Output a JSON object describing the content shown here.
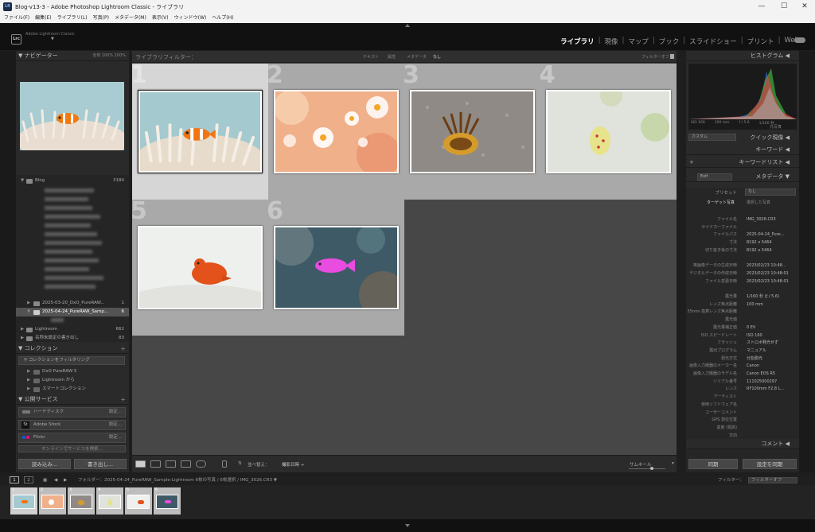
{
  "window": {
    "app_icon": "LR",
    "title": "Blog-v13-3 - Adobe Photoshop Lightroom Classic - ライブラリ",
    "minimize": "—",
    "maximize": "☐",
    "close": "✕"
  },
  "menu": [
    "ファイル(F)",
    "編集(E)",
    "ライブラリ(L)",
    "写真(P)",
    "メタデータ(M)",
    "表示(V)",
    "ウィンドウ(W)",
    "ヘルプ(H)"
  ],
  "identity": {
    "logo": "Lrc",
    "brand": "Adobe Lightroom Classic",
    "arrow": "▼"
  },
  "modules": [
    "ライブラリ",
    "現像",
    "マップ",
    "ブック",
    "スライドショー",
    "プリント",
    "Web"
  ],
  "module_sep": "|",
  "left": {
    "navigator": {
      "title": "ナビゲーター",
      "fit": "全体",
      "zoom1": "100%",
      "zoom2": "100%"
    },
    "folders": {
      "root": {
        "name": "Blog",
        "count": "3184"
      },
      "items": [
        {
          "name": "2025-03-20_DxO_PureRAW...",
          "count": "1"
        },
        {
          "name": "2025-04-24_PureRAW_Samp...",
          "count": "6"
        },
        {
          "name": "Lightroom",
          "count": "662"
        },
        {
          "name": "名称未設定の書き出し",
          "count": "83"
        }
      ]
    },
    "collections": {
      "title": "コレクション",
      "filter": "コレクションをフィルタリング",
      "items": [
        "DxO PureRAW 5",
        "Lightroom から",
        "スマートコレクション"
      ]
    },
    "publish": {
      "title": "公開サービス",
      "items": [
        {
          "name": "ハードディスク",
          "setting": "設定..."
        },
        {
          "name": "Adobe Stock",
          "setting": "設定..."
        },
        {
          "name": "Flickr",
          "setting": "設定..."
        }
      ],
      "more": "オンラインでサービスを検索..."
    },
    "import_btn": "読み込み...",
    "export_btn": "書き出し..."
  },
  "center": {
    "filter_label": "ライブラリフィルター：",
    "filter_tabs": [
      "テキスト",
      "属性",
      "メタデータ",
      "なし"
    ],
    "filter_off": "フィルターオフ ÷",
    "cells": [
      "1",
      "2",
      "3",
      "4",
      "5",
      "6"
    ],
    "toolbar": {
      "sort_label": "並べ替え：",
      "sort_value": "撮影日時 ÷",
      "thumb_label": "サムネール"
    }
  },
  "right": {
    "histogram": {
      "title": "ヒストグラム",
      "iso": "ISO 160",
      "focal": "100 mm",
      "aperture": "f / 5.6",
      "shutter": "1/160 秒"
    },
    "original": "元写真",
    "quick_develop": {
      "title": "クイック現像",
      "preset": "カスタム"
    },
    "keywording": "キーワード",
    "keyword_list": "キーワードリスト",
    "metadata": {
      "title": "メタデータ",
      "mode": "Exif",
      "preset_label": "プリセット",
      "preset_value": "なし",
      "tab1": "ターゲット写真",
      "tab2": "選択した写真",
      "rows": [
        {
          "k": "ファイル名",
          "v": "IMG_3026.CR3"
        },
        {
          "k": "サイドカーファイル",
          "v": ""
        },
        {
          "k": "ファイルパス",
          "v": "2025-04-24_Pure..."
        },
        {
          "k": "寸法",
          "v": "8192 x 5464"
        },
        {
          "k": "切り抜き後の寸法",
          "v": "8192 x 5464"
        },
        {
          "k": "",
          "v": ""
        },
        {
          "k": "英画像データの生成日時",
          "v": "2023/02/23 10:48..."
        },
        {
          "k": "デジタルデータの作成日時",
          "v": "2023/02/23 10:48:01"
        },
        {
          "k": "ファイル変更日時",
          "v": "2023/02/23 10:48:01"
        },
        {
          "k": "",
          "v": ""
        },
        {
          "k": "露光量",
          "v": "1/160 秒 (ƒ / 5.6)"
        },
        {
          "k": "レンズ焦点距離",
          "v": "100 mm"
        },
        {
          "k": "35mm 換算レンズ焦点距離",
          "v": ""
        },
        {
          "k": "露光値",
          "v": ""
        },
        {
          "k": "露光量補正値",
          "v": "0 EV"
        },
        {
          "k": "ISO スピードレート",
          "v": "ISO 160"
        },
        {
          "k": "フラッシュ",
          "v": "ストロボ発光せず"
        },
        {
          "k": "露出プログラム",
          "v": "マニュアル"
        },
        {
          "k": "測光方式",
          "v": "分割測光"
        },
        {
          "k": "画像入力機器のメーカー名",
          "v": "Canon"
        },
        {
          "k": "画像入力機器のモデル名",
          "v": "Canon EOS R5"
        },
        {
          "k": "シリアル番号",
          "v": "111025000297"
        },
        {
          "k": "レンズ",
          "v": "RF100mm F2.8 L..."
        },
        {
          "k": "アーティスト",
          "v": ""
        },
        {
          "k": "使用ソフトウェア名",
          "v": ""
        },
        {
          "k": "ユーザーコメント",
          "v": ""
        },
        {
          "k": "GPS 測位位置",
          "v": ""
        },
        {
          "k": "高度 (標高)",
          "v": ""
        },
        {
          "k": "方向",
          "v": ""
        }
      ]
    },
    "comments": "コメント",
    "sync_btn": "同期",
    "sync_settings_btn": "設定を同期"
  },
  "filmstrip": {
    "page1": "1",
    "page2": "2",
    "path": "フォルダー：2025-04-24_PureRAW_Sample-Lightroom  6枚の写真 / 6枚選択 / IMG_3026.CR3 ▼",
    "filter_label": "フィルター：",
    "filter_value": "フィルターオフ",
    "thumbs": [
      "1",
      "2",
      "3",
      "4",
      "5",
      "6"
    ]
  },
  "colors": {
    "accent": "#ffffff",
    "panel": "#2a2a2a",
    "grid": "#474747"
  }
}
